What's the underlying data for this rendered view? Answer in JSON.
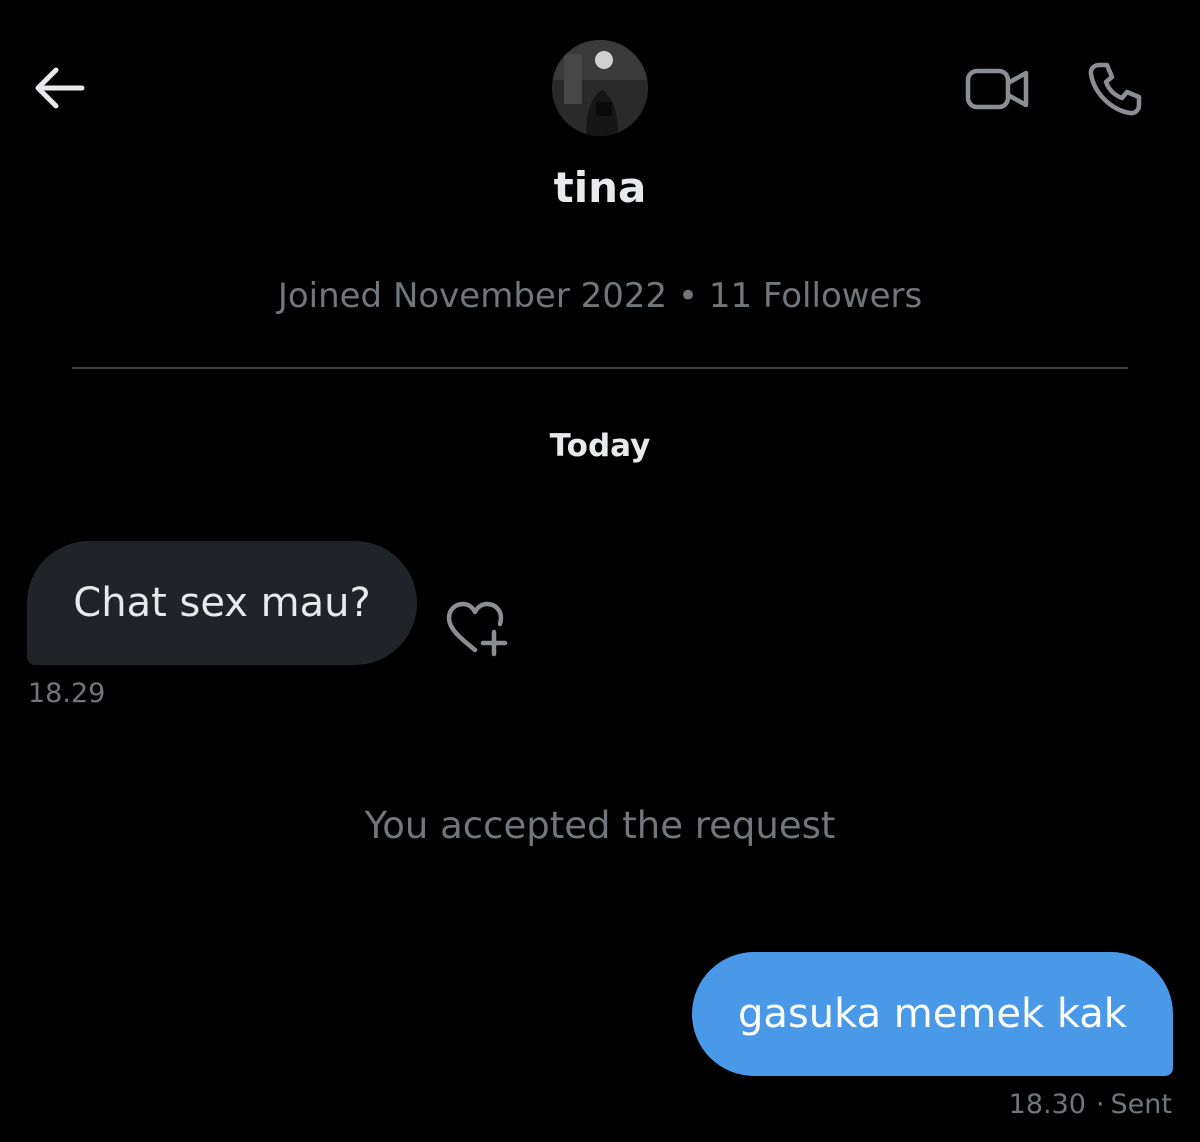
{
  "header": {
    "back_icon": "arrow-left-icon",
    "username": "tina",
    "joined": "Joined November 2022",
    "separator": "•",
    "followers": "11 Followers",
    "video_icon": "video-camera-icon",
    "call_icon": "phone-icon"
  },
  "conversation": {
    "date_label": "Today",
    "messages": [
      {
        "direction": "received",
        "text": "Chat sex mau?",
        "time": "18.29",
        "reaction_icon": "heart-plus-icon"
      },
      {
        "direction": "system",
        "text": "You accepted the request"
      },
      {
        "direction": "sent",
        "text": "gasuka memek kak",
        "time": "18.30",
        "separator": "·",
        "status": "Sent"
      }
    ]
  },
  "colors": {
    "background": "#000000",
    "text_primary": "#e7e9ea",
    "text_secondary": "#71767b",
    "bubble_received": "#202327",
    "bubble_sent": "#4a99e9",
    "divider": "#3e4144"
  }
}
